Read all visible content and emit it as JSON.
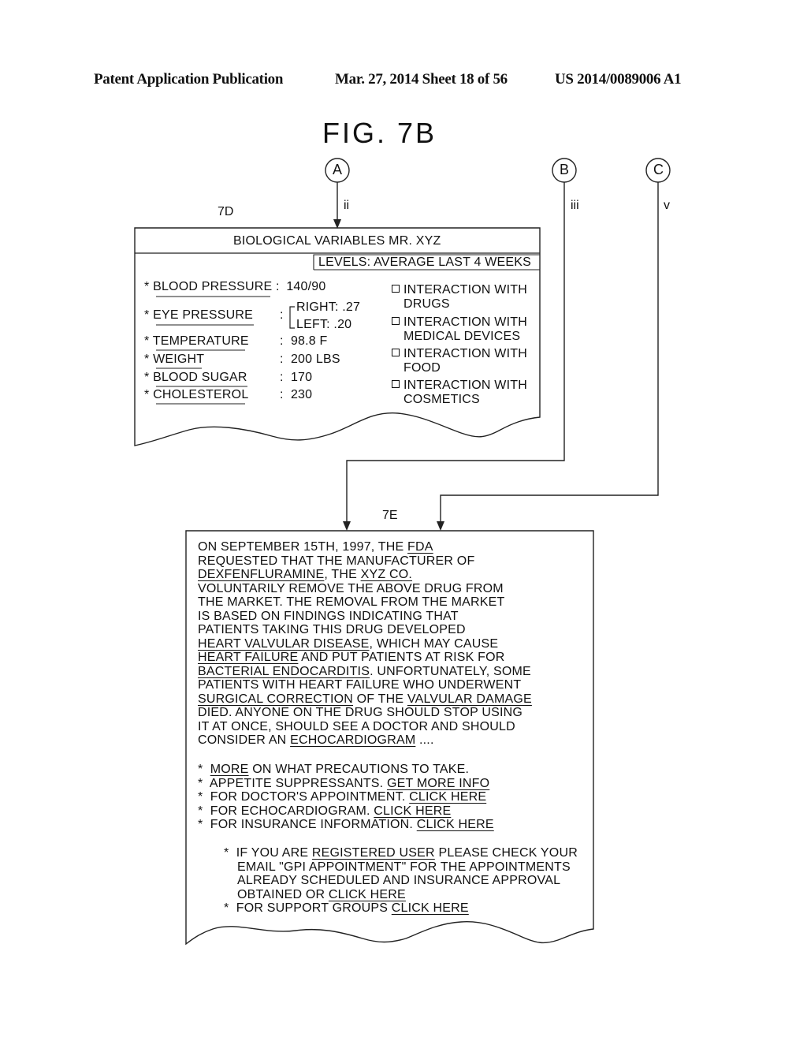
{
  "header": {
    "publication": "Patent Application Publication",
    "date_sheet": "Mar. 27, 2014  Sheet 18 of 56",
    "patent_number": "US 2014/0089006 A1"
  },
  "figure": {
    "title": "FIG. 7B",
    "connectors": [
      {
        "letter": "A",
        "label": "ii"
      },
      {
        "letter": "B",
        "label": "iii"
      },
      {
        "letter": "C",
        "label": "v"
      }
    ]
  },
  "box_7d": {
    "ref": "7D",
    "title": "BIOLOGICAL VARIABLES MR. XYZ",
    "levels": "LEVELS: AVERAGE LAST 4 WEEKS",
    "variables": [
      {
        "name": "BLOOD PRESSURE",
        "value": "140/90"
      },
      {
        "name": "EYE PRESSURE",
        "value_right": "RIGHT: .27",
        "value_left": "LEFT: .20"
      },
      {
        "name": "TEMPERATURE",
        "value": "98.8 F"
      },
      {
        "name": "WEIGHT",
        "value": "200 LBS"
      },
      {
        "name": "BLOOD SUGAR",
        "value": "170"
      },
      {
        "name": "CHOLESTEROL",
        "value": "230"
      }
    ],
    "interactions": [
      {
        "line1": "INTERACTION WITH",
        "line2": "DRUGS"
      },
      {
        "line1": "INTERACTION WITH",
        "line2": "MEDICAL DEVICES"
      },
      {
        "line1": "INTERACTION WITH",
        "line2": "FOOD"
      },
      {
        "line1": "INTERACTION WITH",
        "line2": "COSMETICS"
      }
    ]
  },
  "box_7e": {
    "ref": "7E",
    "paragraph": [
      [
        "ON SEPTEMBER 15TH, 1997, THE ",
        "FDA",
        ""
      ],
      [
        "REQUESTED THAT THE MANUFACTURER OF",
        "",
        ""
      ],
      [
        "",
        "DEXFENFLURAMINE",
        ", THE "
      ],
      [
        "VOLUNTARILY REMOVE THE ABOVE DRUG FROM",
        "",
        ""
      ],
      [
        "THE MARKET.  THE REMOVAL FROM THE MARKET",
        "",
        ""
      ],
      [
        "IS BASED ON FINDINGS INDICATING THAT",
        "",
        ""
      ],
      [
        "PATIENTS TAKING THIS DRUG DEVELOPED",
        "",
        ""
      ],
      [
        "",
        "HEART VALVULAR DISEASE",
        ", WHICH MAY CAUSE"
      ],
      [
        "",
        "HEART FAILURE",
        " AND PUT PATIENTS AT RISK FOR"
      ],
      [
        "",
        "BACTERIAL ENDOCARDITIS",
        ".  UNFORTUNATELY, SOME"
      ],
      [
        "PATIENTS WITH HEART FAILURE WHO UNDERWENT",
        "",
        ""
      ],
      [
        "",
        "SURGICAL CORRECTION",
        " OF THE "
      ],
      [
        "DIED.  ANYONE ON THE DRUG SHOULD STOP USING",
        "",
        ""
      ],
      [
        "IT AT ONCE, SHOULD SEE A DOCTOR AND SHOULD",
        "",
        ""
      ],
      [
        "CONSIDER AN ",
        "ECHOCARDIOGRAM",
        " ...."
      ]
    ],
    "xyz_co": "XYZ CO.",
    "valvular_damage": "VALVULAR DAMAGE",
    "bullets": [
      {
        "pre": "",
        "link": "MORE",
        "post": " ON WHAT PRECAUTIONS TO TAKE."
      },
      {
        "pre": "APPETITE SUPPRESSANTS.  ",
        "link": "GET MORE INFO",
        "post": ""
      },
      {
        "pre": "FOR DOCTOR'S APPOINTMENT.  ",
        "link": "CLICK HERE",
        "post": ""
      },
      {
        "pre": "FOR ECHOCARDIOGRAM.  ",
        "link": "CLICK HERE",
        "post": ""
      },
      {
        "pre": "FOR INSURANCE INFORMATION.  ",
        "link": "CLICK HERE",
        "post": ""
      }
    ],
    "registered": {
      "l1_pre": "IF YOU ARE ",
      "l1_link": "REGISTERED USER",
      "l1_post": " PLEASE CHECK YOUR",
      "l2": "EMAIL \"GPI APPOINTMENT\" FOR THE APPOINTMENTS",
      "l3": "ALREADY SCHEDULED AND INSURANCE APPROVAL",
      "l4_pre": "OBTAINED OR ",
      "l4_link": "CLICK HERE"
    },
    "support": {
      "pre": " FOR SUPPORT GROUPS ",
      "link": "CLICK HERE"
    },
    "asterisk": "*"
  }
}
